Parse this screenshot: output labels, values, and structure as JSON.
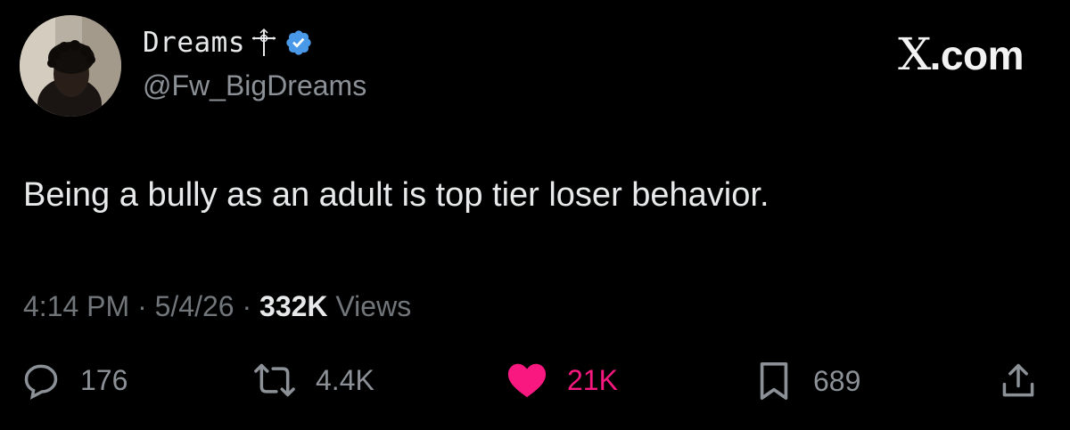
{
  "author": {
    "display_name": "Dreams",
    "handle": "@Fw_BigDreams",
    "verified": true,
    "badge_color": "#4a99e9"
  },
  "brand": {
    "label_x": "X",
    "label_rest": ".com"
  },
  "tweet": {
    "text": "Being a bully as an adult is top tier loser behavior.",
    "time": "4:14 PM",
    "date": "5/4/26",
    "views_count": "332K",
    "views_label": "Views"
  },
  "actions": {
    "replies": {
      "icon": "reply-icon",
      "count": "176"
    },
    "reposts": {
      "icon": "repost-icon",
      "count": "4.4K"
    },
    "likes": {
      "icon": "heart-icon",
      "count": "21K",
      "color": "#f91880",
      "liked": true
    },
    "bookmarks": {
      "icon": "bookmark-icon",
      "count": "689"
    },
    "share": {
      "icon": "share-icon"
    }
  },
  "colors": {
    "background": "#000000",
    "text_primary": "#e7e9ea",
    "text_secondary": "#71767b"
  }
}
